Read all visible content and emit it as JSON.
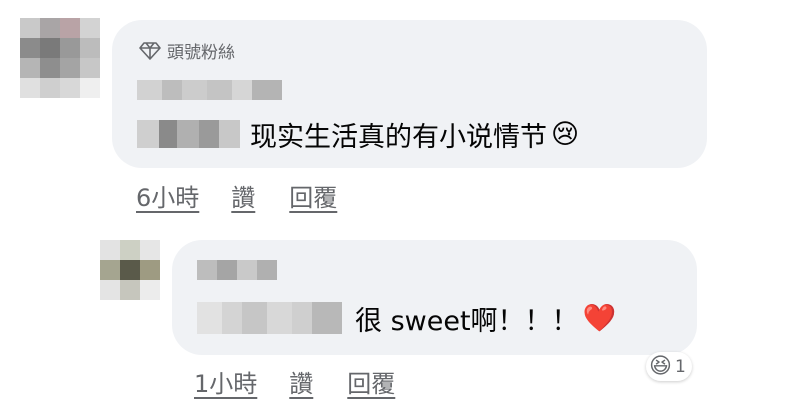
{
  "comments": [
    {
      "badge": "頭號粉絲",
      "text": "现实生活真的有小说情节",
      "emoji": "😢",
      "time": "6小時",
      "like": "讚",
      "reply": "回覆"
    },
    {
      "text": "很 sweet啊！！！",
      "emoji": "❤️",
      "reaction_emoji": "😆",
      "reaction_count": "1",
      "time": "1小時",
      "like": "讚",
      "reply": "回覆"
    }
  ],
  "icons": [
    "diamond-icon"
  ],
  "colors": {
    "bubble": "#f0f2f5",
    "secondary_text": "#65676b",
    "text": "#050505"
  }
}
